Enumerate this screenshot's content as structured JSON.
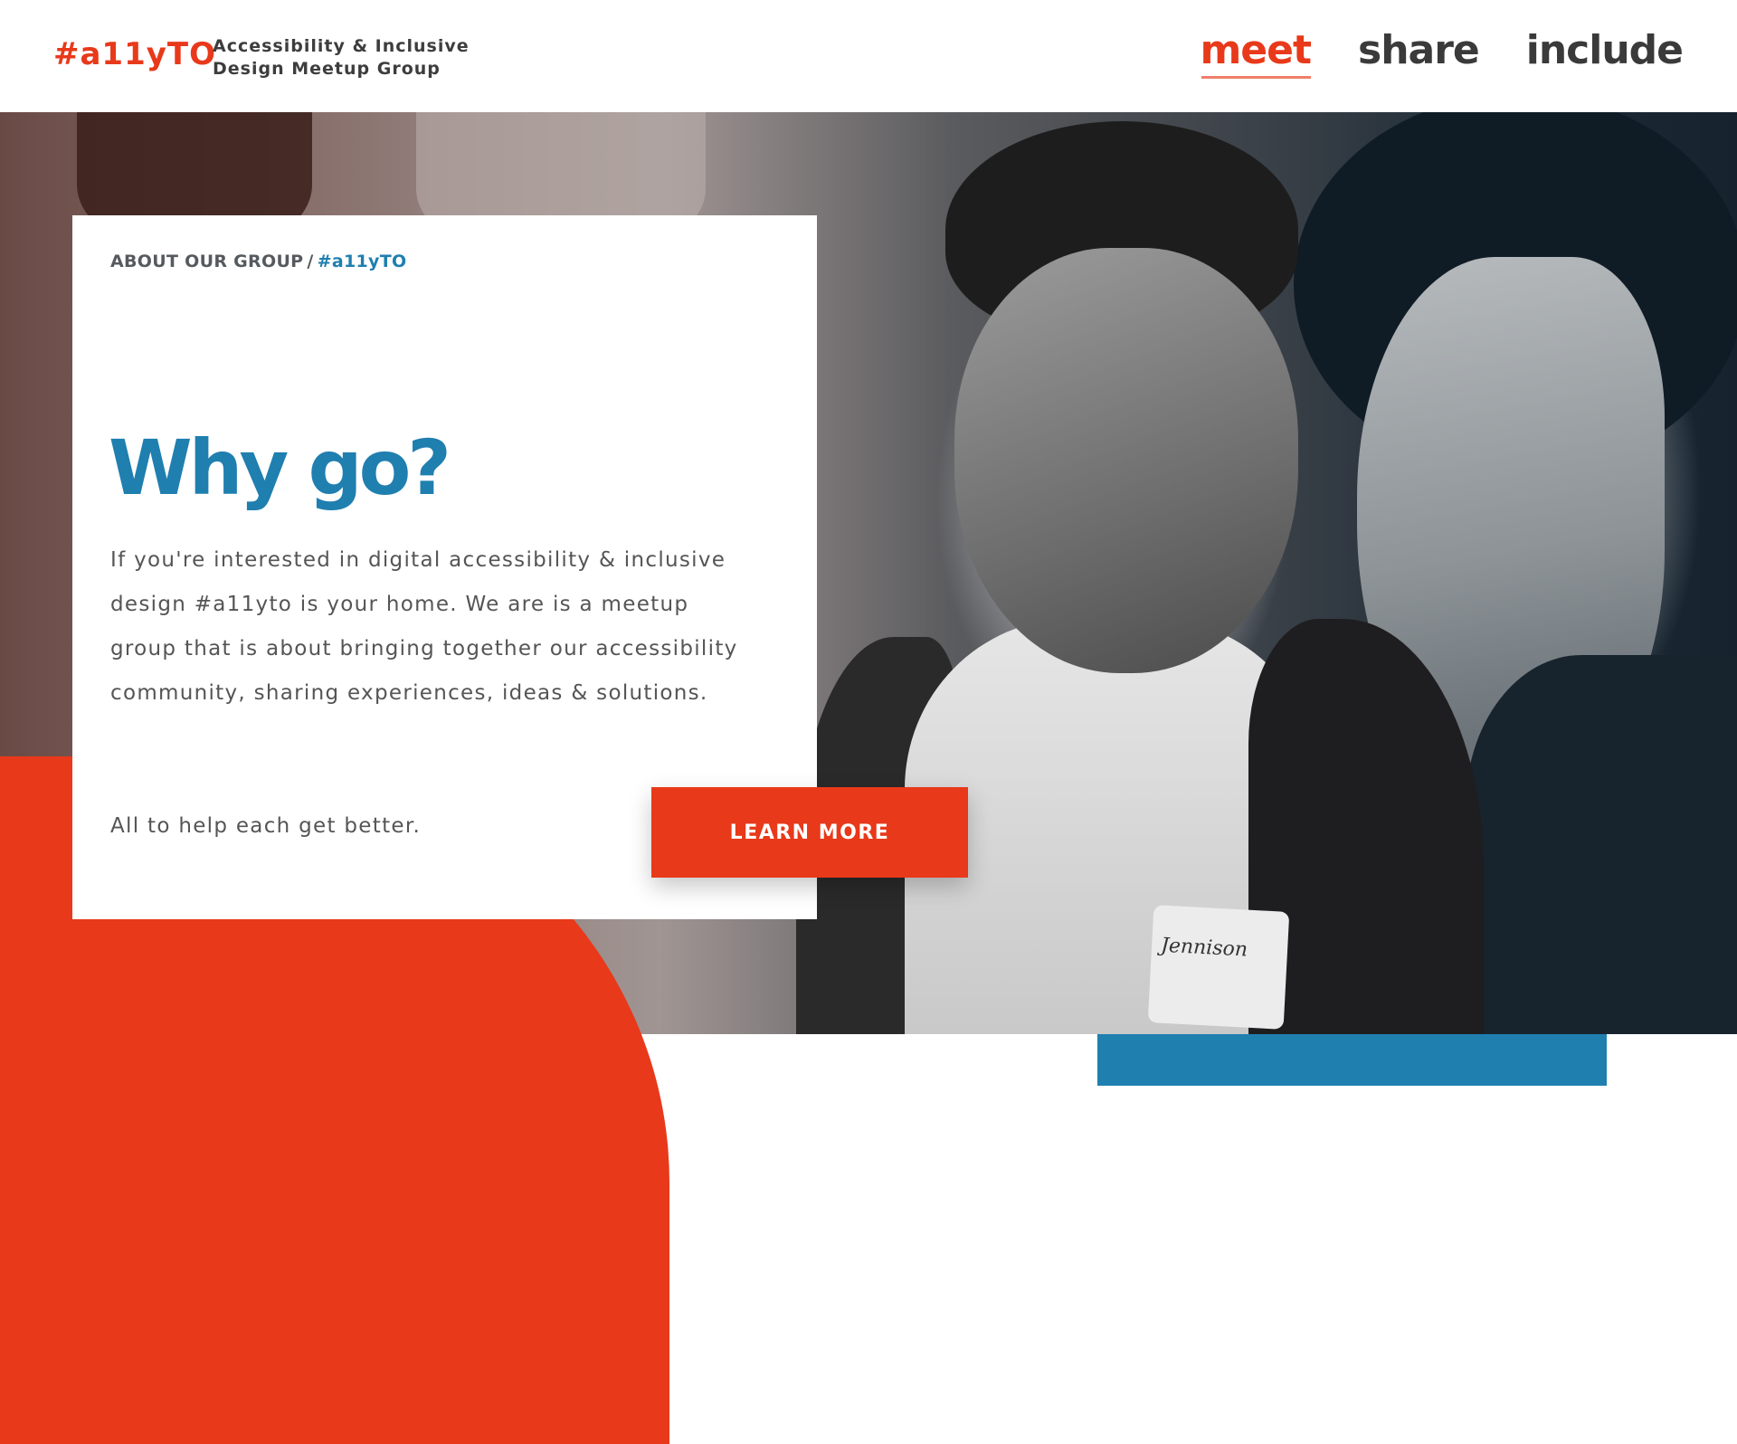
{
  "header": {
    "logo": "#a11yTO",
    "tagline_line1": "Accessibility & Inclusive",
    "tagline_line2": "Design Meetup Group",
    "nav": [
      {
        "label": "meet",
        "active": true
      },
      {
        "label": "share",
        "active": false
      },
      {
        "label": "include",
        "active": false
      }
    ]
  },
  "hero": {
    "name_tag_text": "Jennison",
    "card": {
      "breadcrumb_section": "ABOUT OUR GROUP",
      "breadcrumb_separator": "/",
      "breadcrumb_tag": "#a11yTO",
      "title": "Why go?",
      "body": "If you're interested in digital accessibility & inclusive design #a11yto is your home. We are is a meetup group that is about bringing together our accessibility community, sharing experiences, ideas & solutions.",
      "note": "All to help each get better."
    },
    "cta_label": "LEARN MORE"
  },
  "colors": {
    "brand_orange": "#e8391a",
    "brand_blue": "#1f7faf",
    "text_dark": "#3a3a3a"
  }
}
